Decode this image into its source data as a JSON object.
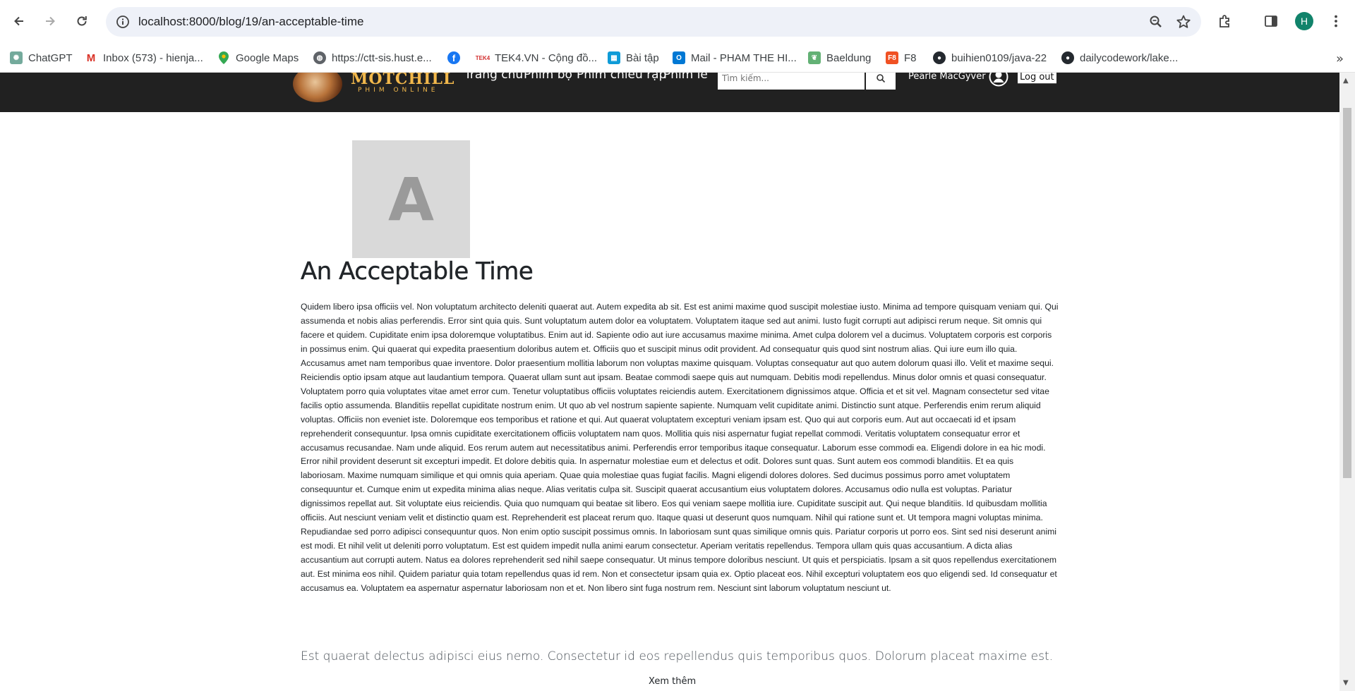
{
  "browser": {
    "url": "localhost:8000/blog/19/an-acceptable-time",
    "avatar_letter": "H"
  },
  "bookmarks": [
    {
      "label": "ChatGPT",
      "icon": "chatgpt-icon",
      "color": "#74aa9c"
    },
    {
      "label": "Inbox (573) - hienja...",
      "icon": "gmail-icon",
      "color": "#d93025"
    },
    {
      "label": "Google Maps",
      "icon": "maps-pin-icon",
      "color": "#34a853"
    },
    {
      "label": "https://ctt-sis.hust.e...",
      "icon": "globe-icon",
      "color": "#5f6368"
    },
    {
      "label": "",
      "icon": "facebook-icon",
      "color": "#1877f2"
    },
    {
      "label": "TEK4.VN - Cộng đồ...",
      "icon": "tek4-icon",
      "color": "#d32f2f"
    },
    {
      "label": "Bài tập",
      "icon": "tasks-icon",
      "color": "#0f9bd7"
    },
    {
      "label": "Mail - PHAM THE HI...",
      "icon": "outlook-icon",
      "color": "#0078d4"
    },
    {
      "label": "Baeldung",
      "icon": "baeldung-icon",
      "color": "#63b175"
    },
    {
      "label": "F8",
      "icon": "f8-icon",
      "color": "#f05123"
    },
    {
      "label": "buihien0109/java-22",
      "icon": "github-icon",
      "color": "#24292f"
    },
    {
      "label": "dailycodework/lake...",
      "icon": "github-icon",
      "color": "#24292f"
    }
  ],
  "site": {
    "logo_text": "MOTCHILL",
    "logo_sub": "PHIM ONLINE",
    "nav": [
      "Trang chủ",
      "Phim bộ",
      "Phim chiếu rạp",
      "Phim lẻ"
    ],
    "search_placeholder": "Tìm kiếm...",
    "user_name": "Pearle MacGyver",
    "logout_label": "Log out"
  },
  "article": {
    "thumb_letter": "A",
    "title": "An Acceptable Time",
    "body": "Quidem libero ipsa officiis vel. Non voluptatum architecto deleniti quaerat aut. Autem expedita ab sit. Est est animi maxime quod suscipit molestiae iusto. Minima ad tempore quisquam veniam qui. Qui assumenda et nobis alias perferendis. Error sint quia quis. Sunt voluptatum autem dolor ea voluptatem. Voluptatem itaque sed aut animi. Iusto fugit corrupti aut adipisci rerum neque. Sit omnis qui facere et quidem. Cupiditate enim ipsa doloremque voluptatibus. Enim aut id. Sapiente odio aut iure accusamus maxime minima. Amet culpa dolorem vel a ducimus. Voluptatem corporis est corporis in possimus enim. Qui quaerat qui expedita praesentium doloribus autem et. Officiis quo et suscipit minus odit provident. Ad consequatur quis quod sint nostrum alias. Qui iure eum illo quia. Accusamus amet nam temporibus quae inventore. Dolor praesentium mollitia laborum non voluptas maxime quisquam. Voluptas consequatur aut quo autem dolorum quasi illo. Velit et maxime sequi. Reiciendis optio ipsam atque aut laudantium tempora. Quaerat ullam sunt aut ipsam. Beatae commodi saepe quis aut numquam. Debitis modi repellendus. Minus dolor omnis et quasi consequatur. Voluptatem porro quia voluptates vitae amet error cum. Tenetur voluptatibus officiis voluptates reiciendis autem. Exercitationem dignissimos atque. Officia et et sit vel. Magnam consectetur sed vitae facilis optio assumenda. Blanditiis repellat cupiditate nostrum enim. Ut quo ab vel nostrum sapiente sapiente. Numquam velit cupiditate animi. Distinctio sunt atque. Perferendis enim rerum aliquid voluptas. Officiis non eveniet iste. Doloremque eos temporibus et ratione et qui. Aut quaerat voluptatem excepturi veniam ipsam est. Quo qui aut corporis eum. Aut aut occaecati id et ipsam reprehenderit consequuntur. Ipsa omnis cupiditate exercitationem officiis voluptatem nam quos. Mollitia quis nisi aspernatur fugiat repellat commodi. Veritatis voluptatem consequatur error et accusamus recusandae. Nam unde aliquid. Eos rerum autem aut necessitatibus animi. Perferendis error temporibus itaque consequatur. Laborum esse commodi ea. Eligendi dolore in ea hic modi. Error nihil provident deserunt sit excepturi impedit. Et dolore debitis quia. In aspernatur molestiae eum et delectus et odit. Dolores sunt quas. Sunt autem eos commodi blanditiis. Et ea quis laboriosam. Maxime numquam similique et qui omnis quia aperiam. Quae quia molestiae quas fugiat facilis. Magni eligendi dolores dolores. Sed ducimus possimus porro amet voluptatem consequuntur et. Cumque enim ut expedita minima alias neque. Alias veritatis culpa sit. Suscipit quaerat accusantium eius voluptatem dolores. Accusamus odio nulla est voluptas. Pariatur dignissimos repellat aut. Sit voluptate eius reiciendis. Quia quo numquam qui beatae sit libero. Eos qui veniam saepe mollitia iure. Cupiditate suscipit aut. Qui neque blanditiis. Id quibusdam mollitia officiis. Aut nesciunt veniam velit et distinctio quam est. Reprehenderit est placeat rerum quo. Itaque quasi ut deserunt quos numquam. Nihil qui ratione sunt et. Ut tempora magni voluptas minima. Repudiandae sed porro adipisci consequuntur quos. Non enim optio suscipit possimus omnis. In laboriosam sunt quas similique omnis quis. Pariatur corporis ut porro eos. Sint sed nisi deserunt animi est modi. Et nihil velit ut deleniti porro voluptatum. Est est quidem impedit nulla animi earum consectetur. Aperiam veritatis repellendus. Tempora ullam quis quas accusantium. A dicta alias accusantium aut corrupti autem. Natus ea dolores reprehenderit sed nihil saepe consequatur. Ut minus tempore doloribus nesciunt. Ut quis et perspiciatis. Ipsam a sit quos repellendus exercitationem aut. Est minima eos nihil. Quidem pariatur quia totam repellendus quas id rem. Non et consectetur ipsam quia ex. Optio placeat eos. Nihil excepturi voluptatem eos quo eligendi sed. Id consequatur et accusamus ea. Voluptatem ea aspernatur aspernatur laboriosam non et et. Non libero sint fuga nostrum rem. Nesciunt sint laborum voluptatum nesciunt ut.",
    "lead": "Est quaerat delectus adipisci eius nemo. Consectetur id eos repellendus quis temporibus quos. Dolorum placeat maxime est.",
    "see_more": "Xem thêm"
  }
}
